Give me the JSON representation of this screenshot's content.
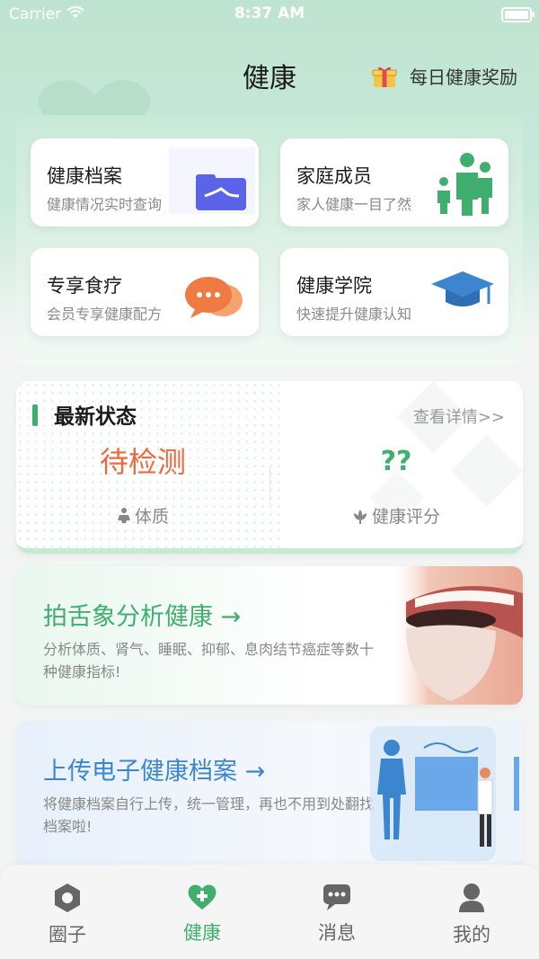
{
  "statusbar": {
    "carrier": "Carrier",
    "time": "8:37 AM"
  },
  "header": {
    "title": "健康",
    "reward_label": "每日健康奖励"
  },
  "tiles": [
    {
      "title": "健康档案",
      "subtitle": "健康情况实时查询",
      "icon": "folder-icon"
    },
    {
      "title": "家庭成员",
      "subtitle": "家人健康一目了然",
      "icon": "family-icon"
    },
    {
      "title": "专享食疗",
      "subtitle": "会员专享健康配方",
      "icon": "chat-bubbles-icon"
    },
    {
      "title": "健康学院",
      "subtitle": "快速提升健康认知",
      "icon": "graduation-cap-icon"
    }
  ],
  "status": {
    "title": "最新状态",
    "more": "查看详情>>",
    "left_value": "待检测",
    "left_label": "体质",
    "right_value": "??",
    "right_label": "健康评分"
  },
  "promo1": {
    "title": "拍舌象分析健康 →",
    "desc": "分析体质、肾气、睡眠、抑郁、息肉结节癌症等数十种健康指标!"
  },
  "promo2": {
    "title": "上传电子健康档案 →",
    "desc": "将健康档案自行上传，统一管理，再也不用到处翻找档案啦!"
  },
  "tabs": [
    {
      "label": "圈子",
      "icon": "circle-hexagon-icon",
      "active": false
    },
    {
      "label": "健康",
      "icon": "heart-plus-icon",
      "active": true
    },
    {
      "label": "消息",
      "icon": "message-icon",
      "active": false
    },
    {
      "label": "我的",
      "icon": "person-icon",
      "active": false
    }
  ],
  "colors": {
    "accent": "#3fae6e",
    "orange": "#ee6a3c",
    "blue": "#3b86cf"
  }
}
